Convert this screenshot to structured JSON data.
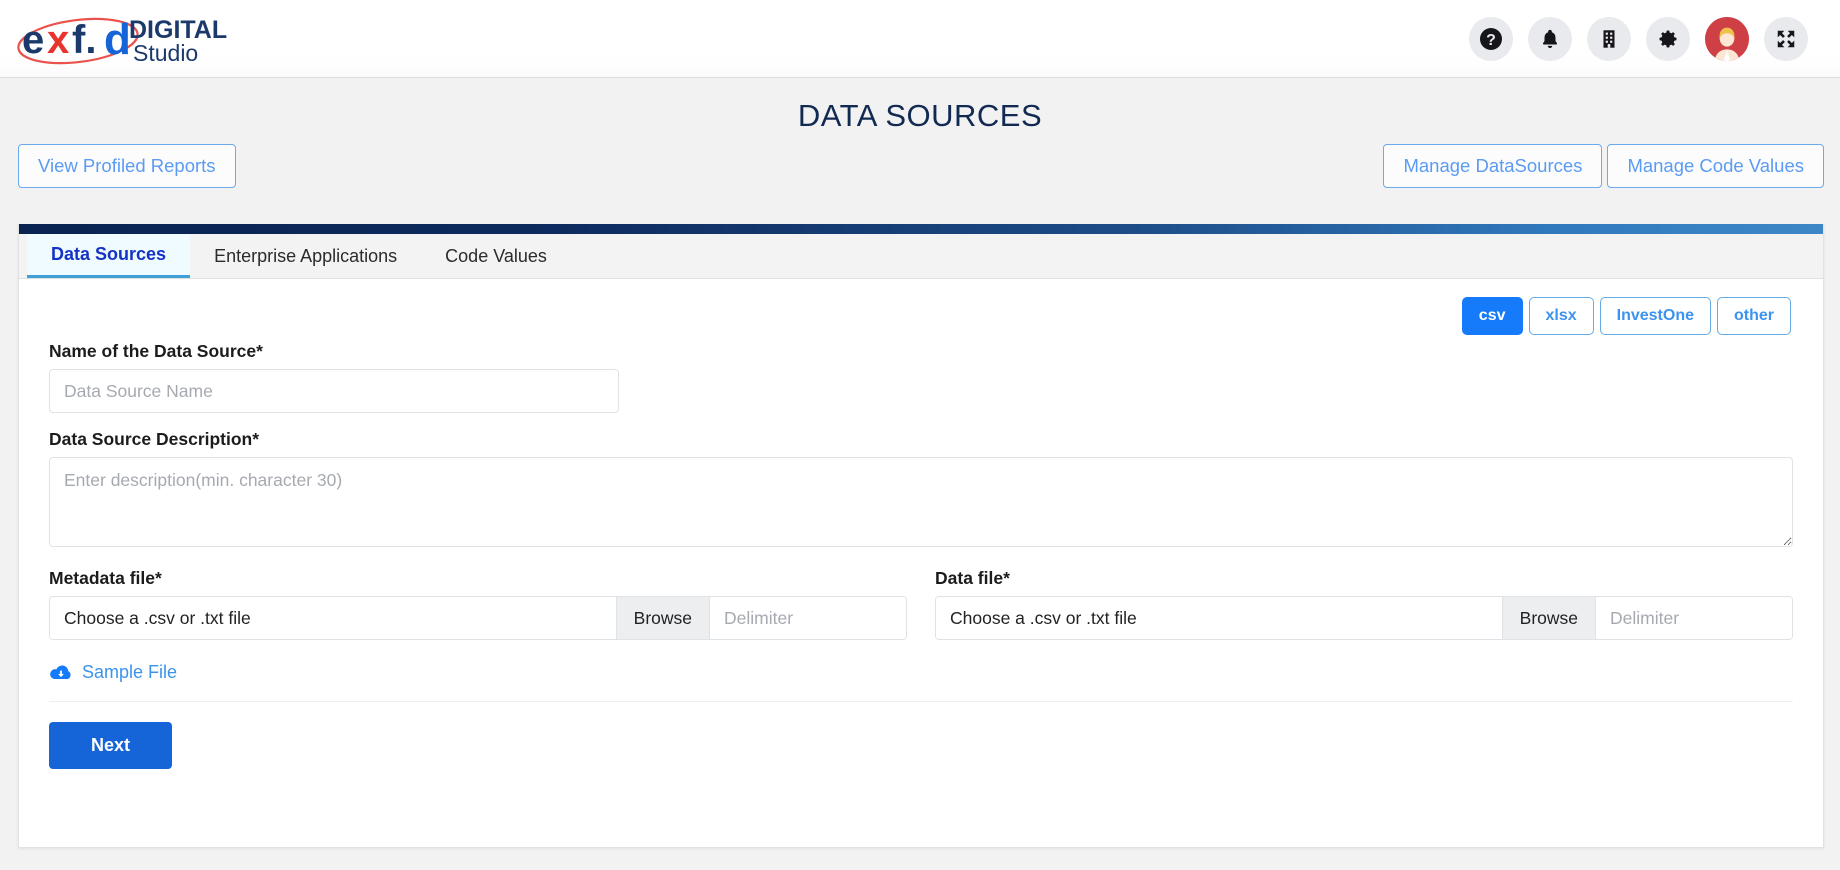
{
  "header": {
    "logo": {
      "primary_text": "exf.",
      "secondary_text": "DIGITAL",
      "tertiary_text": "Studio",
      "navy_color": "#1b3a6b",
      "red_color": "#e8342c",
      "blue_color": "#1565d8"
    },
    "icons": [
      {
        "name": "help-icon",
        "glyph": "?"
      },
      {
        "name": "notifications-bell-icon",
        "glyph": "bell"
      },
      {
        "name": "organization-building-icon",
        "glyph": "building"
      },
      {
        "name": "settings-gear-icon",
        "glyph": "gear"
      },
      {
        "name": "user-avatar-icon",
        "glyph": "avatar"
      },
      {
        "name": "fullscreen-expand-icon",
        "glyph": "expand"
      }
    ]
  },
  "page": {
    "title": "DATA SOURCES",
    "title_color": "#122a52",
    "accent_blue": "#157bfb"
  },
  "actions": {
    "view_profiled_reports": "View Profiled Reports",
    "manage_datasources": "Manage DataSources",
    "manage_code_values": "Manage Code Values"
  },
  "tabs": [
    {
      "label": "Data Sources",
      "active": true
    },
    {
      "label": "Enterprise Applications",
      "active": false
    },
    {
      "label": "Code Values",
      "active": false
    }
  ],
  "file_types": [
    {
      "label": "csv",
      "active": true
    },
    {
      "label": "xlsx",
      "active": false
    },
    {
      "label": "InvestOne",
      "active": false
    },
    {
      "label": "other",
      "active": false
    }
  ],
  "form": {
    "name_label": "Name of the Data Source*",
    "name_value": "",
    "name_placeholder": "Data Source Name",
    "description_label": "Data Source Description*",
    "description_value": "",
    "description_placeholder": "Enter description(min. character 30)",
    "metadata_file": {
      "label": "Metadata file*",
      "file_text": "Choose a .csv or .txt file",
      "browse_label": "Browse",
      "delimiter_value": "",
      "delimiter_placeholder": "Delimiter"
    },
    "data_file": {
      "label": "Data file*",
      "file_text": "Choose a .csv or .txt file",
      "browse_label": "Browse",
      "delimiter_value": "",
      "delimiter_placeholder": "Delimiter"
    },
    "sample_file_link": "Sample File",
    "next_label": "Next"
  }
}
